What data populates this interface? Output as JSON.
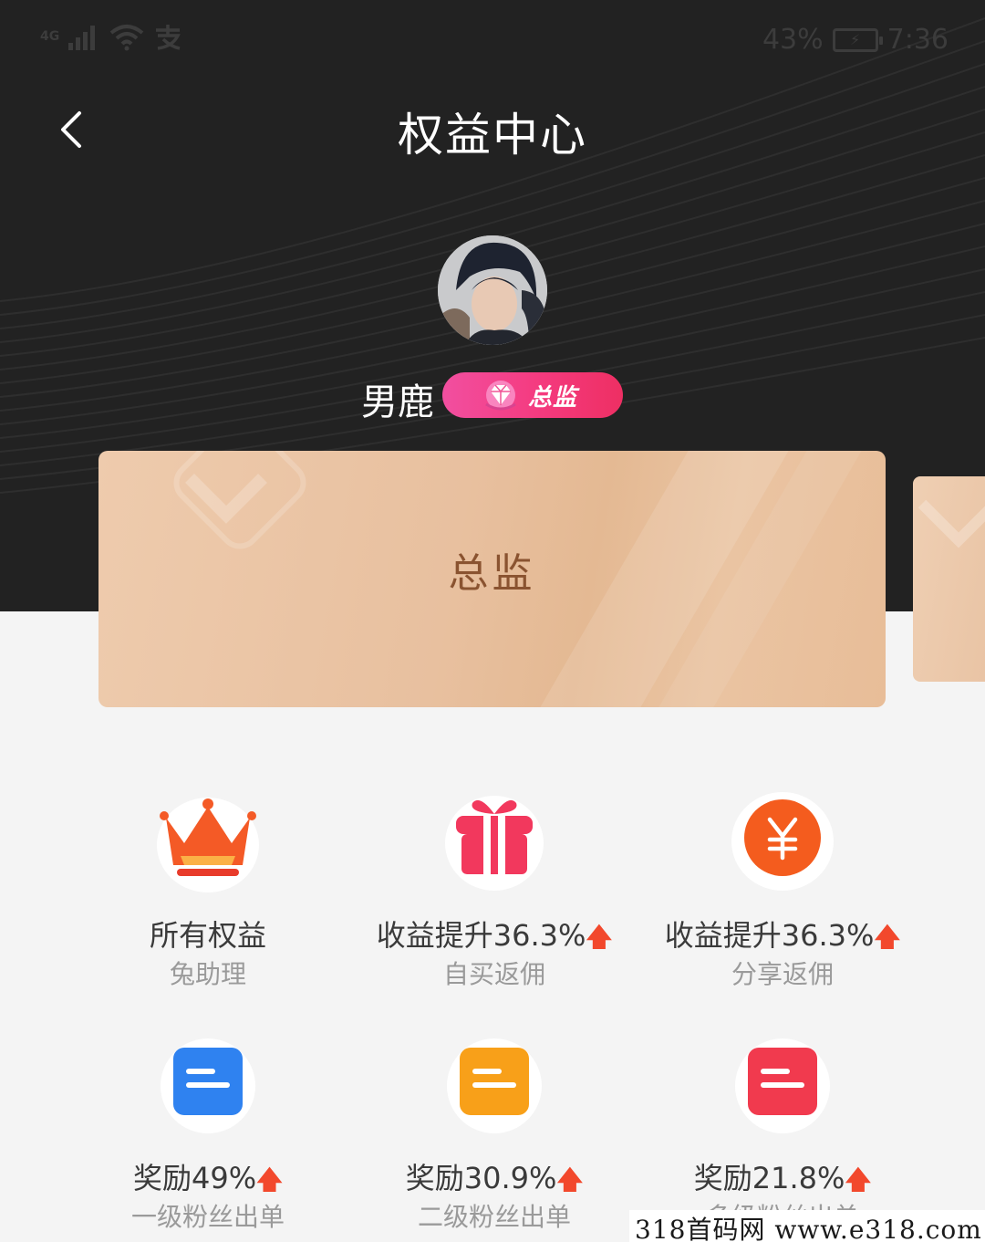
{
  "status_bar": {
    "network": "4G",
    "app_indicator_icon": "alipay-icon",
    "battery_percent": "43%",
    "time": "7:36"
  },
  "header": {
    "back_icon": "chevron-left-icon",
    "title": "权益中心"
  },
  "profile": {
    "username": "男鹿",
    "level_badge": "总监",
    "badge_icon": "diamond-icon"
  },
  "level_card": {
    "title": "总监"
  },
  "benefits": [
    {
      "icon": "crown-icon",
      "title": "所有权益",
      "subtitle": "兔助理",
      "arrow": ""
    },
    {
      "icon": "gift-icon",
      "title": "收益提升36.3%",
      "subtitle": "自买返佣",
      "arrow": "🡅"
    },
    {
      "icon": "yuan-coin-icon",
      "title": "收益提升36.3%",
      "subtitle": "分享返佣",
      "arrow": "🡅"
    },
    {
      "icon": "reward-blue-icon",
      "title": "奖励49%",
      "subtitle": "一级粉丝出单",
      "arrow": "🡅"
    },
    {
      "icon": "reward-orange-icon",
      "title": "奖励30.9%",
      "subtitle": "二级粉丝出单",
      "arrow": "🡅"
    },
    {
      "icon": "reward-red-icon",
      "title": "奖励21.8%",
      "subtitle": "多级粉丝出单",
      "arrow": "🡅"
    }
  ],
  "watermark": "318首码网  www.e318.com",
  "colors": {
    "hero_background": "#222222",
    "card_gold": "#e8c09f",
    "badge_pink": "#f43a7e",
    "accent_red": "#f2482c"
  }
}
